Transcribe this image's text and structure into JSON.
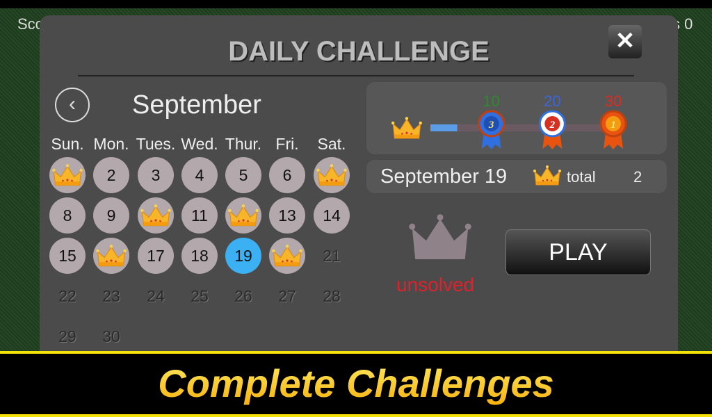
{
  "background": {
    "score_label_partial": "Sco",
    "right_label_partial": "s 0"
  },
  "dialog": {
    "title": "DAILY CHALLENGE",
    "close": "✕"
  },
  "calendar": {
    "month": "September",
    "weekdays": [
      "Sun.",
      "Mon.",
      "Tues.",
      "Wed.",
      "Thur.",
      "Fri.",
      "Sat."
    ],
    "days": [
      {
        "n": "1",
        "solved": true
      },
      {
        "n": "2"
      },
      {
        "n": "3"
      },
      {
        "n": "4"
      },
      {
        "n": "5"
      },
      {
        "n": "6"
      },
      {
        "n": "7",
        "solved": true
      },
      {
        "n": "8"
      },
      {
        "n": "9"
      },
      {
        "n": "10",
        "solved": true
      },
      {
        "n": "11"
      },
      {
        "n": "12",
        "solved": true
      },
      {
        "n": "13"
      },
      {
        "n": "14"
      },
      {
        "n": "15"
      },
      {
        "n": "16",
        "solved": true
      },
      {
        "n": "17"
      },
      {
        "n": "18"
      },
      {
        "n": "19",
        "selected": true
      },
      {
        "n": "20",
        "solved": true
      },
      {
        "n": "21",
        "future": true
      },
      {
        "n": "22",
        "future": true
      },
      {
        "n": "23",
        "future": true
      },
      {
        "n": "24",
        "future": true
      },
      {
        "n": "25",
        "future": true
      },
      {
        "n": "26",
        "future": true
      },
      {
        "n": "27",
        "future": true
      },
      {
        "n": "28",
        "future": true
      },
      {
        "n": "29",
        "future": true
      },
      {
        "n": "30",
        "future": true
      }
    ]
  },
  "progress": {
    "current": 2,
    "max": 30,
    "milestones": [
      {
        "label": "10",
        "rank": "3",
        "color": "#2f8a2f"
      },
      {
        "label": "20",
        "rank": "2",
        "color": "#3a66e0"
      },
      {
        "label": "30",
        "rank": "1",
        "color": "#e02a20"
      }
    ]
  },
  "info": {
    "date": "September 19",
    "total_label": "total",
    "total": "2"
  },
  "status": "unsolved",
  "play": "PLAY",
  "banner": "Complete Challenges"
}
